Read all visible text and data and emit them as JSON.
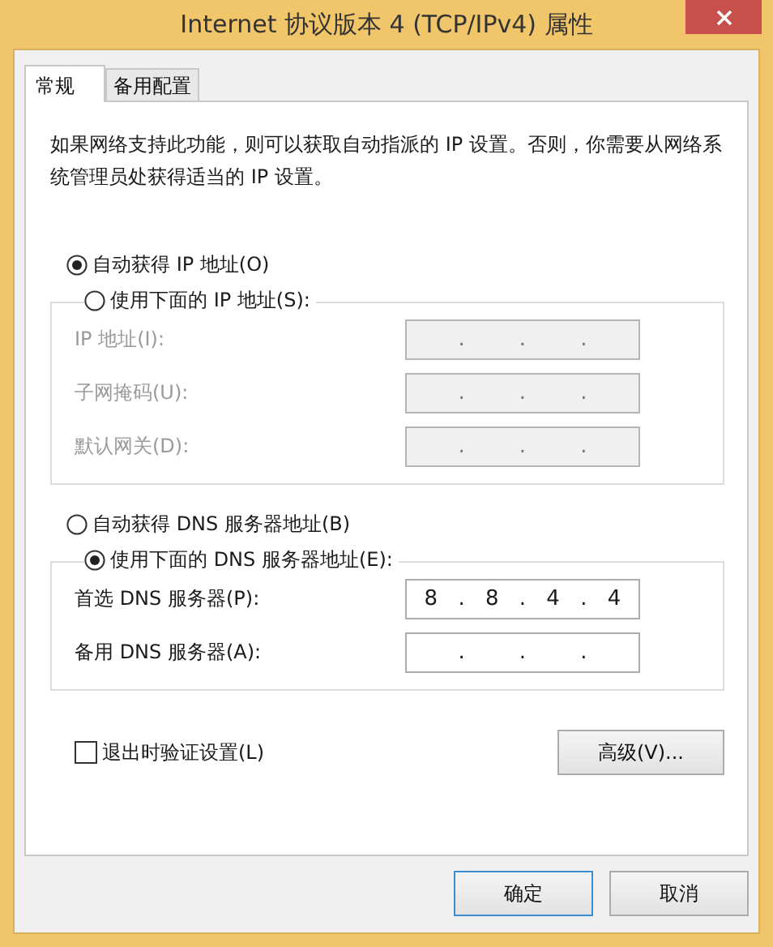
{
  "window": {
    "title": "Internet 协议版本 4 (TCP/IPv4) 属性"
  },
  "tabs": [
    {
      "label": "常规",
      "selected": true
    },
    {
      "label": "备用配置",
      "selected": false
    }
  ],
  "description": "如果网络支持此功能，则可以获取自动指派的 IP 设置。否则，你需要从网络系统管理员处获得适当的 IP 设置。",
  "ip_auto": {
    "label": "自动获得 IP 地址(O)",
    "selected": true
  },
  "ip_manual": {
    "label": "使用下面的 IP 地址(S):",
    "selected": false,
    "disabled": true,
    "fields": [
      {
        "label": "IP 地址(I):",
        "dots": [
          ".",
          ".",
          "."
        ]
      },
      {
        "label": "子网掩码(U):",
        "dots": [
          ".",
          ".",
          "."
        ]
      },
      {
        "label": "默认网关(D):",
        "dots": [
          ".",
          ".",
          "."
        ]
      }
    ]
  },
  "dns_auto": {
    "label": "自动获得 DNS 服务器地址(B)",
    "selected": false
  },
  "dns_manual": {
    "label": "使用下面的 DNS 服务器地址(E):",
    "selected": true,
    "disabled": false,
    "fields": [
      {
        "label": "首选 DNS 服务器(P):",
        "octets": [
          "8",
          "8",
          "4",
          "4"
        ],
        "dots": [
          ".",
          ".",
          "."
        ]
      },
      {
        "label": "备用 DNS 服务器(A):",
        "dots": [
          ".",
          ".",
          "."
        ]
      }
    ]
  },
  "validate": {
    "label": "退出时验证设置(L)",
    "checked": false
  },
  "advanced_button": "高级(V)...",
  "buttons": [
    {
      "label": "确定",
      "default": true
    },
    {
      "label": "取消",
      "default": false
    }
  ]
}
